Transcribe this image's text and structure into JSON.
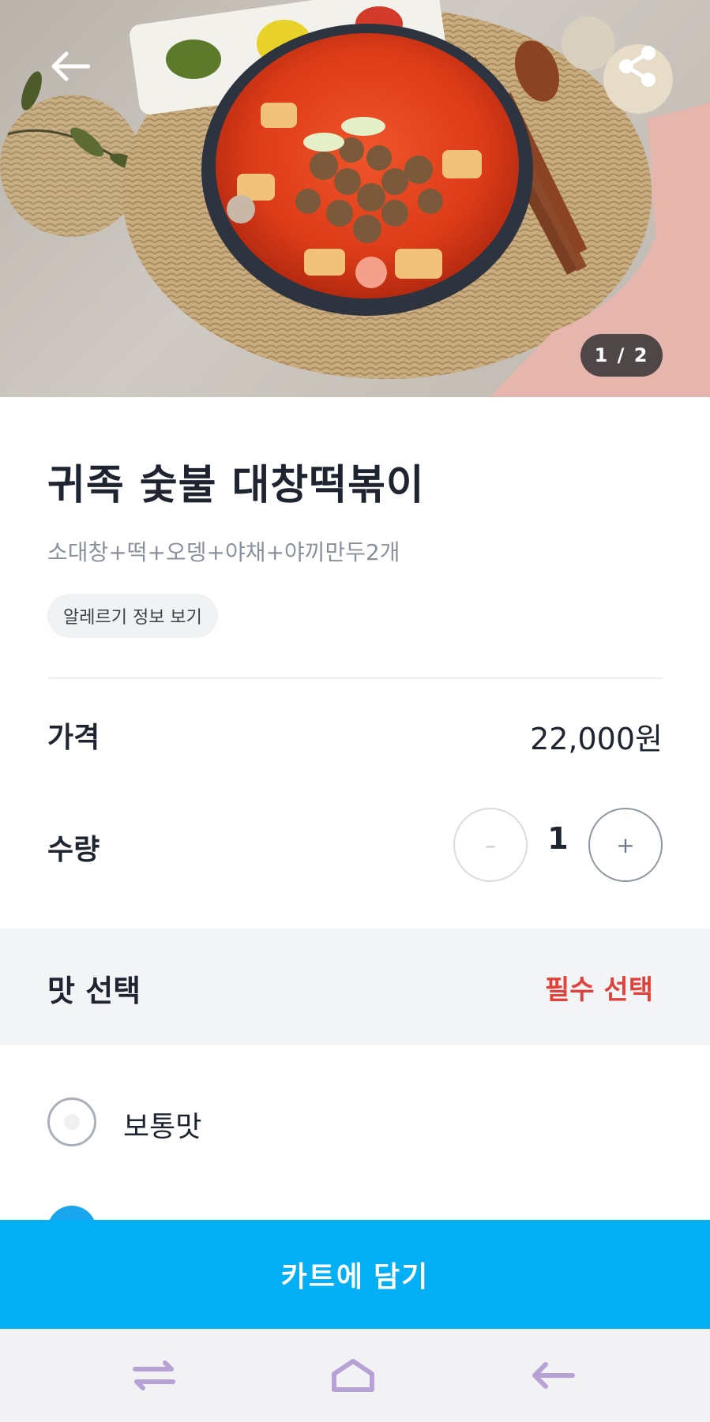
{
  "hero": {
    "page_indicator": "1 / 2",
    "back_icon": "arrow-left-icon",
    "share_icon": "share-icon"
  },
  "product": {
    "title": "귀족 숯불 대창떡볶이",
    "description": "소대창+떡+오뎅+야채+야끼만두2개",
    "allergy_button": "알레르기 정보 보기"
  },
  "price": {
    "label": "가격",
    "value": "22,000원"
  },
  "quantity": {
    "label": "수량",
    "minus": "–",
    "value": "1",
    "plus": "+"
  },
  "option_group": {
    "title": "맛 선택",
    "required": "필수 선택",
    "options": [
      {
        "label": "보통맛",
        "selected": false
      }
    ]
  },
  "cta": {
    "label": "카트에 담기"
  },
  "system_nav": {
    "icons": [
      "recent-apps-icon",
      "home-icon",
      "back-icon"
    ]
  },
  "colors": {
    "accent": "#04b0f5",
    "required": "#e0413b",
    "nav_icon": "#b7a2d6"
  }
}
